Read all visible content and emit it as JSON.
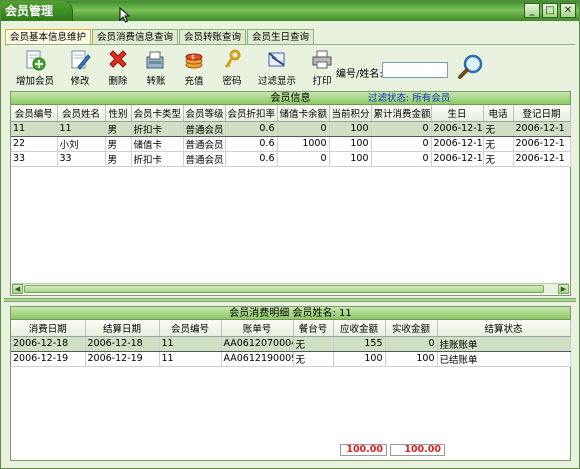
{
  "window": {
    "title": "会员管理",
    "minimize": "_",
    "maximize": "□",
    "close": "✕"
  },
  "tabs": [
    "会员基本信息维护",
    "会员消费信息查询",
    "会员转账查询",
    "会员生日查询"
  ],
  "toolbar": {
    "buttons": [
      {
        "label": "增加会员",
        "icon": "add-member-icon"
      },
      {
        "label": "修改",
        "icon": "edit-icon"
      },
      {
        "label": "删除",
        "icon": "delete-icon"
      },
      {
        "label": "转账",
        "icon": "transfer-icon"
      },
      {
        "label": "充值",
        "icon": "recharge-icon"
      },
      {
        "label": "密码",
        "icon": "key-icon"
      },
      {
        "label": "过滤显示",
        "icon": "filter-icon"
      },
      {
        "label": "打印",
        "icon": "printer-icon"
      }
    ],
    "search_label": "编号/姓名:",
    "search_value": ""
  },
  "member_panel": {
    "title": "会员信息",
    "filter_status": "过滤状态: 所有会员",
    "columns": [
      "会员编号",
      "会员姓名",
      "性别",
      "会员卡类型",
      "会员等级",
      "会员折扣率",
      "储值卡余额",
      "当前积分",
      "累计消费金额",
      "生日",
      "电话",
      "登记日期"
    ],
    "rows": [
      [
        "11",
        "11",
        "男",
        "折扣卡",
        "普通会员",
        "0.6",
        "0",
        "100",
        "0",
        "2006-12-1",
        "无",
        "2006-12-1"
      ],
      [
        "22",
        "小刘",
        "男",
        "储值卡",
        "普通会员",
        "0.6",
        "1000",
        "100",
        "0",
        "2006-12-1",
        "无",
        "2006-12-1"
      ],
      [
        "33",
        "33",
        "男",
        "折扣卡",
        "普通会员",
        "0.6",
        "0",
        "100",
        "0",
        "2006-12-1",
        "无",
        "2006-12-1"
      ]
    ]
  },
  "consumption_panel": {
    "title": "会员消费明细 会员姓名: 11",
    "columns": [
      "消费日期",
      "结算日期",
      "会员编号",
      "账单号",
      "餐台号",
      "应收金额",
      "实收金额",
      "结算状态"
    ],
    "rows": [
      [
        "2006-12-18",
        "2006-12-18",
        "11",
        "AA0612070004",
        "无",
        "155",
        "0",
        "挂账账单"
      ],
      [
        "2006-12-19",
        "2006-12-19",
        "11",
        "AA0612190009",
        "无",
        "100",
        "100",
        "已结账单"
      ]
    ],
    "total_receivable": "100.00",
    "total_received": "100.00"
  },
  "colors": {
    "title_green": "#3a8f2a",
    "header_green": "#8fc968",
    "total_red": "#e02020",
    "filter_blue": "#1432c8"
  }
}
